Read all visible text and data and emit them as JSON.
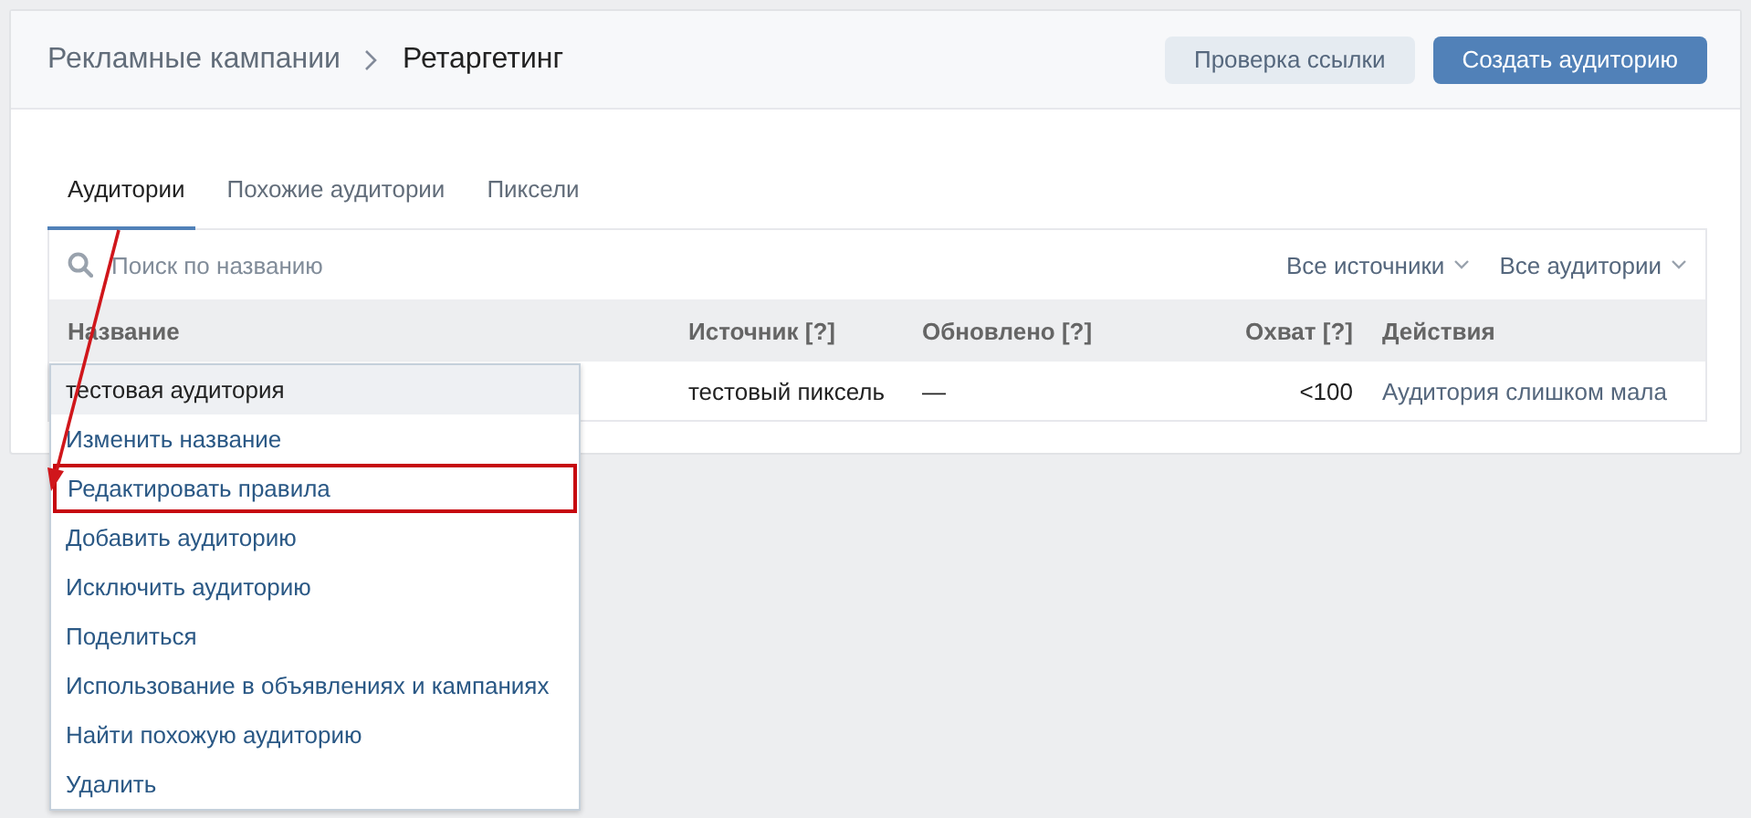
{
  "breadcrumbs": [
    {
      "label": "Рекламные кампании",
      "current": false
    },
    {
      "label": "Ретаргетинг",
      "current": true
    }
  ],
  "buttons": [
    {
      "label": "Проверка ссылки",
      "kind": "secondary"
    },
    {
      "label": "Создать аудиторию",
      "kind": "primary"
    }
  ],
  "tabs": [
    {
      "label": "Аудитории",
      "selected": true
    },
    {
      "label": "Похожие аудитории",
      "selected": false
    },
    {
      "label": "Пиксели",
      "selected": false
    }
  ],
  "search": {
    "placeholder": "Поиск по названию"
  },
  "filters": [
    "Все источники",
    "Все аудитории"
  ],
  "table": {
    "columns": [
      "Название",
      "Источник [?]",
      "Обновлено [?]",
      "Охват [?]",
      "Действия"
    ],
    "rows": [
      {
        "source": "тестовый пиксель",
        "updated": "—",
        "reach": "<100",
        "actions": "Аудитория слишком мала"
      }
    ]
  },
  "menu": {
    "items": [
      {
        "label": "тестовая аудитория",
        "kind": "header",
        "highlighted": false
      },
      {
        "label": "Изменить название",
        "kind": "item",
        "highlighted": false
      },
      {
        "label": "Редактировать правила",
        "kind": "item",
        "highlighted": true
      },
      {
        "label": "Добавить аудиторию",
        "kind": "item",
        "highlighted": false
      },
      {
        "label": "Исключить аудиторию",
        "kind": "item",
        "highlighted": false
      },
      {
        "label": "Поделиться",
        "kind": "item",
        "highlighted": false
      },
      {
        "label": "Использование в объявлениях и кампаниях",
        "kind": "item",
        "highlighted": false
      },
      {
        "label": "Найти похожую аудиторию",
        "kind": "item",
        "highlighted": false
      },
      {
        "label": "Удалить",
        "kind": "item",
        "highlighted": false
      }
    ]
  }
}
